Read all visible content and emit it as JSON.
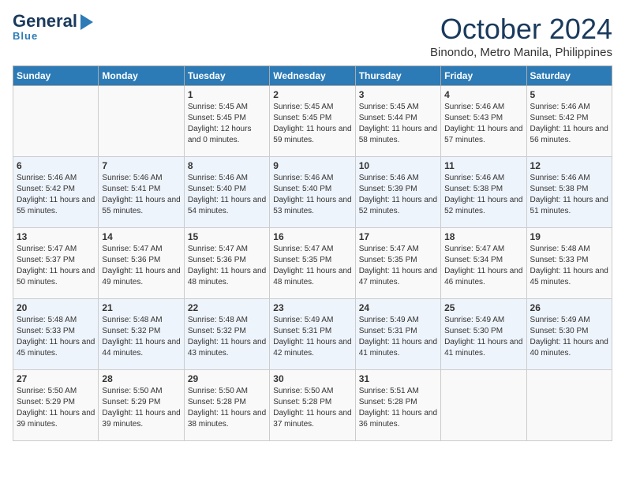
{
  "header": {
    "logo_top": "General",
    "logo_bottom": "Blue",
    "month": "October 2024",
    "location": "Binondo, Metro Manila, Philippines"
  },
  "days_of_week": [
    "Sunday",
    "Monday",
    "Tuesday",
    "Wednesday",
    "Thursday",
    "Friday",
    "Saturday"
  ],
  "weeks": [
    [
      {
        "num": "",
        "text": ""
      },
      {
        "num": "",
        "text": ""
      },
      {
        "num": "1",
        "text": "Sunrise: 5:45 AM\nSunset: 5:45 PM\nDaylight: 12 hours and 0 minutes."
      },
      {
        "num": "2",
        "text": "Sunrise: 5:45 AM\nSunset: 5:45 PM\nDaylight: 11 hours and 59 minutes."
      },
      {
        "num": "3",
        "text": "Sunrise: 5:45 AM\nSunset: 5:44 PM\nDaylight: 11 hours and 58 minutes."
      },
      {
        "num": "4",
        "text": "Sunrise: 5:46 AM\nSunset: 5:43 PM\nDaylight: 11 hours and 57 minutes."
      },
      {
        "num": "5",
        "text": "Sunrise: 5:46 AM\nSunset: 5:42 PM\nDaylight: 11 hours and 56 minutes."
      }
    ],
    [
      {
        "num": "6",
        "text": "Sunrise: 5:46 AM\nSunset: 5:42 PM\nDaylight: 11 hours and 55 minutes."
      },
      {
        "num": "7",
        "text": "Sunrise: 5:46 AM\nSunset: 5:41 PM\nDaylight: 11 hours and 55 minutes."
      },
      {
        "num": "8",
        "text": "Sunrise: 5:46 AM\nSunset: 5:40 PM\nDaylight: 11 hours and 54 minutes."
      },
      {
        "num": "9",
        "text": "Sunrise: 5:46 AM\nSunset: 5:40 PM\nDaylight: 11 hours and 53 minutes."
      },
      {
        "num": "10",
        "text": "Sunrise: 5:46 AM\nSunset: 5:39 PM\nDaylight: 11 hours and 52 minutes."
      },
      {
        "num": "11",
        "text": "Sunrise: 5:46 AM\nSunset: 5:38 PM\nDaylight: 11 hours and 52 minutes."
      },
      {
        "num": "12",
        "text": "Sunrise: 5:46 AM\nSunset: 5:38 PM\nDaylight: 11 hours and 51 minutes."
      }
    ],
    [
      {
        "num": "13",
        "text": "Sunrise: 5:47 AM\nSunset: 5:37 PM\nDaylight: 11 hours and 50 minutes."
      },
      {
        "num": "14",
        "text": "Sunrise: 5:47 AM\nSunset: 5:36 PM\nDaylight: 11 hours and 49 minutes."
      },
      {
        "num": "15",
        "text": "Sunrise: 5:47 AM\nSunset: 5:36 PM\nDaylight: 11 hours and 48 minutes."
      },
      {
        "num": "16",
        "text": "Sunrise: 5:47 AM\nSunset: 5:35 PM\nDaylight: 11 hours and 48 minutes."
      },
      {
        "num": "17",
        "text": "Sunrise: 5:47 AM\nSunset: 5:35 PM\nDaylight: 11 hours and 47 minutes."
      },
      {
        "num": "18",
        "text": "Sunrise: 5:47 AM\nSunset: 5:34 PM\nDaylight: 11 hours and 46 minutes."
      },
      {
        "num": "19",
        "text": "Sunrise: 5:48 AM\nSunset: 5:33 PM\nDaylight: 11 hours and 45 minutes."
      }
    ],
    [
      {
        "num": "20",
        "text": "Sunrise: 5:48 AM\nSunset: 5:33 PM\nDaylight: 11 hours and 45 minutes."
      },
      {
        "num": "21",
        "text": "Sunrise: 5:48 AM\nSunset: 5:32 PM\nDaylight: 11 hours and 44 minutes."
      },
      {
        "num": "22",
        "text": "Sunrise: 5:48 AM\nSunset: 5:32 PM\nDaylight: 11 hours and 43 minutes."
      },
      {
        "num": "23",
        "text": "Sunrise: 5:49 AM\nSunset: 5:31 PM\nDaylight: 11 hours and 42 minutes."
      },
      {
        "num": "24",
        "text": "Sunrise: 5:49 AM\nSunset: 5:31 PM\nDaylight: 11 hours and 41 minutes."
      },
      {
        "num": "25",
        "text": "Sunrise: 5:49 AM\nSunset: 5:30 PM\nDaylight: 11 hours and 41 minutes."
      },
      {
        "num": "26",
        "text": "Sunrise: 5:49 AM\nSunset: 5:30 PM\nDaylight: 11 hours and 40 minutes."
      }
    ],
    [
      {
        "num": "27",
        "text": "Sunrise: 5:50 AM\nSunset: 5:29 PM\nDaylight: 11 hours and 39 minutes."
      },
      {
        "num": "28",
        "text": "Sunrise: 5:50 AM\nSunset: 5:29 PM\nDaylight: 11 hours and 39 minutes."
      },
      {
        "num": "29",
        "text": "Sunrise: 5:50 AM\nSunset: 5:28 PM\nDaylight: 11 hours and 38 minutes."
      },
      {
        "num": "30",
        "text": "Sunrise: 5:50 AM\nSunset: 5:28 PM\nDaylight: 11 hours and 37 minutes."
      },
      {
        "num": "31",
        "text": "Sunrise: 5:51 AM\nSunset: 5:28 PM\nDaylight: 11 hours and 36 minutes."
      },
      {
        "num": "",
        "text": ""
      },
      {
        "num": "",
        "text": ""
      }
    ]
  ]
}
